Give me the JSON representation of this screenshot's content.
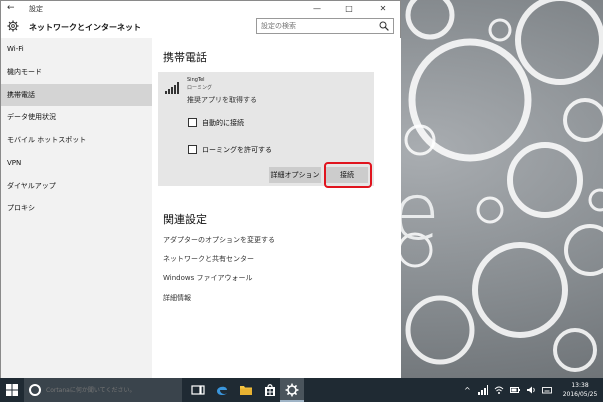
{
  "window": {
    "back_glyph": "←",
    "title": "設定",
    "minimize_glyph": "—",
    "maximize_glyph": "□",
    "close_glyph": "✕"
  },
  "header": {
    "title": "ネットワークとインターネット",
    "search_placeholder": "設定の検索"
  },
  "sidebar": {
    "items": [
      {
        "label": "Wi-Fi"
      },
      {
        "label": "機内モード"
      },
      {
        "label": "携帯電話"
      },
      {
        "label": "データ使用状況"
      },
      {
        "label": "モバイル ホットスポット"
      },
      {
        "label": "VPN"
      },
      {
        "label": "ダイヤルアップ"
      },
      {
        "label": "プロキシ"
      }
    ],
    "selected_index": 2
  },
  "main": {
    "title": "携帯電話",
    "card": {
      "carrier": "SingTel",
      "carrier_sub": "ローミング",
      "status": "推奨アプリを取得する",
      "auto_connect_label": "自動的に接続",
      "roaming_label": "ローミングを許可する",
      "advanced_button": "詳細オプション",
      "connect_button": "接続"
    },
    "related": {
      "title": "関連設定",
      "links": [
        "アダプターのオプションを変更する",
        "ネットワークと共有センター",
        "Windows ファイアウォール",
        "詳細情報"
      ]
    }
  },
  "desktop": {
    "wallpaper_letter": "e"
  },
  "taskbar": {
    "cortana_placeholder": "Cortanaに何か聞いてください。",
    "clock_time": "13:38",
    "clock_date": "2016/05/25",
    "tray_chevron": "^"
  },
  "colors": {
    "highlight": "#e0141e",
    "selected_nav": "#d4d4d4",
    "card_bg": "#e6e6e6",
    "taskbar": "#1f2a33"
  }
}
